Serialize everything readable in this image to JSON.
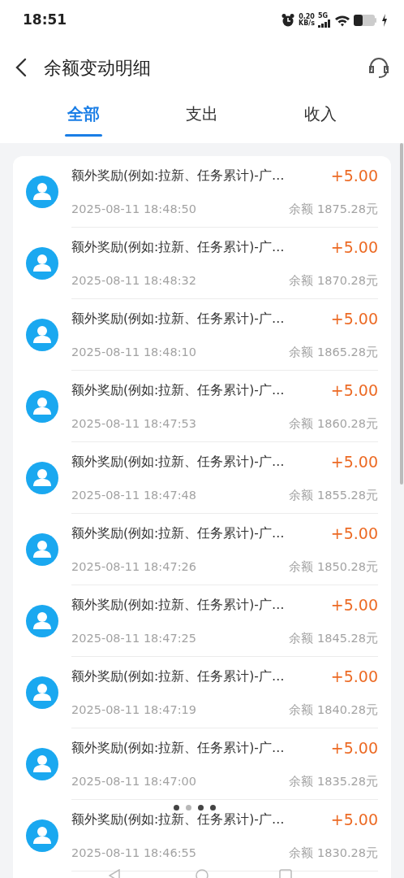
{
  "status_bar": {
    "time": "18:51",
    "speed": "0.20",
    "speed_unit": "KB/s",
    "network": "5G"
  },
  "header": {
    "title": "余额变动明细"
  },
  "tabs": [
    {
      "label": "全部",
      "selected": true
    },
    {
      "label": "支出",
      "selected": false
    },
    {
      "label": "收入",
      "selected": false
    }
  ],
  "records": [
    {
      "title": "额外奖励(例如:拉新、任务累计)-广…",
      "amount": "+5.00",
      "time": "2025-08-11 18:48:50",
      "balance": "余额 1875.28元"
    },
    {
      "title": "额外奖励(例如:拉新、任务累计)-广…",
      "amount": "+5.00",
      "time": "2025-08-11 18:48:32",
      "balance": "余额 1870.28元"
    },
    {
      "title": "额外奖励(例如:拉新、任务累计)-广…",
      "amount": "+5.00",
      "time": "2025-08-11 18:48:10",
      "balance": "余额 1865.28元"
    },
    {
      "title": "额外奖励(例如:拉新、任务累计)-广…",
      "amount": "+5.00",
      "time": "2025-08-11 18:47:53",
      "balance": "余额 1860.28元"
    },
    {
      "title": "额外奖励(例如:拉新、任务累计)-广…",
      "amount": "+5.00",
      "time": "2025-08-11 18:47:48",
      "balance": "余额 1855.28元"
    },
    {
      "title": "额外奖励(例如:拉新、任务累计)-广…",
      "amount": "+5.00",
      "time": "2025-08-11 18:47:26",
      "balance": "余额 1850.28元"
    },
    {
      "title": "额外奖励(例如:拉新、任务累计)-广…",
      "amount": "+5.00",
      "time": "2025-08-11 18:47:25",
      "balance": "余额 1845.28元"
    },
    {
      "title": "额外奖励(例如:拉新、任务累计)-广…",
      "amount": "+5.00",
      "time": "2025-08-11 18:47:19",
      "balance": "余额 1840.28元"
    },
    {
      "title": "额外奖励(例如:拉新、任务累计)-广…",
      "amount": "+5.00",
      "time": "2025-08-11 18:47:00",
      "balance": "余额 1835.28元"
    },
    {
      "title": "额外奖励(例如:拉新、任务累计)-广…",
      "amount": "+5.00",
      "time": "2025-08-11 18:46:55",
      "balance": "余额 1830.28元"
    }
  ],
  "page_dots": [
    {
      "selected": false
    },
    {
      "selected": true
    },
    {
      "selected": false
    },
    {
      "selected": false
    }
  ]
}
